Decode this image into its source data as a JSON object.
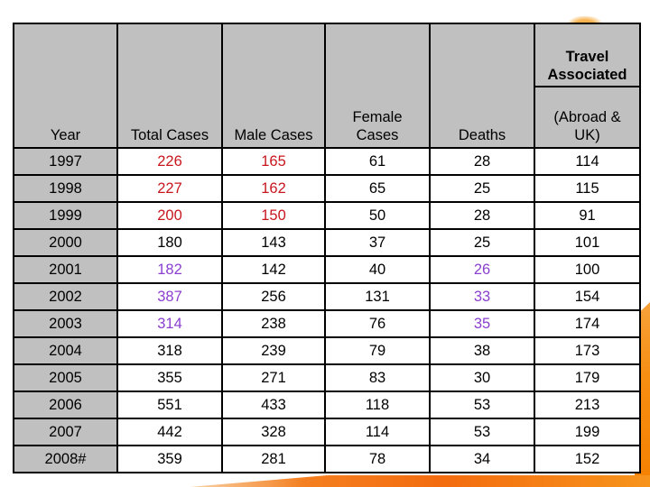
{
  "table": {
    "headers": {
      "year": "Year",
      "total_cases": "Total Cases",
      "male_cases": "Male Cases",
      "female_cases_line1": "Female",
      "female_cases_line2": "Cases",
      "deaths": "Deaths",
      "travel_group_line1": "Travel",
      "travel_group_line2": "Associated",
      "travel_sub_line1": "(Abroad &",
      "travel_sub_line2": "UK)"
    },
    "highlight_colors": {
      "red": "#c8161e",
      "purple": "#8a3fcf",
      "header_bg": "#c0c0c0",
      "accent_orange": "#f47f20"
    },
    "rows": [
      {
        "year": "1997",
        "total": "226",
        "male": "165",
        "female": "61",
        "deaths": "28",
        "travel": "114"
      },
      {
        "year": "1998",
        "total": "227",
        "male": "162",
        "female": "65",
        "deaths": "25",
        "travel": "115"
      },
      {
        "year": "1999",
        "total": "200",
        "male": "150",
        "female": "50",
        "deaths": "28",
        "travel": "91"
      },
      {
        "year": "2000",
        "total": "180",
        "male": "143",
        "female": "37",
        "deaths": "25",
        "travel": "101"
      },
      {
        "year": "2001",
        "total": "182",
        "male": "142",
        "female": "40",
        "deaths": "26",
        "travel": "100"
      },
      {
        "year": "2002",
        "total": "387",
        "male": "256",
        "female": "131",
        "deaths": "33",
        "travel": "154"
      },
      {
        "year": "2003",
        "total": "314",
        "male": "238",
        "female": "76",
        "deaths": "35",
        "travel": "174"
      },
      {
        "year": "2004",
        "total": "318",
        "male": "239",
        "female": "79",
        "deaths": "38",
        "travel": "173"
      },
      {
        "year": "2005",
        "total": "355",
        "male": "271",
        "female": "83",
        "deaths": "30",
        "travel": "179"
      },
      {
        "year": "2006",
        "total": "551",
        "male": "433",
        "female": "118",
        "deaths": "53",
        "travel": "213"
      },
      {
        "year": "2007",
        "total": "442",
        "male": "328",
        "female": "114",
        "deaths": "53",
        "travel": "199"
      },
      {
        "year": "2008#",
        "total": "359",
        "male": "281",
        "female": "78",
        "deaths": "34",
        "travel": "152"
      }
    ]
  }
}
